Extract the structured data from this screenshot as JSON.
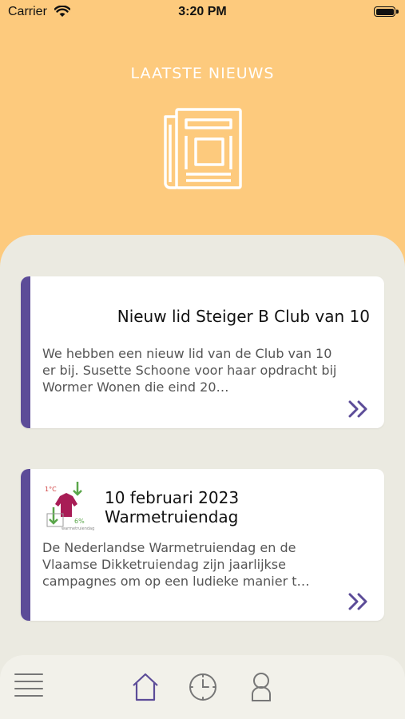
{
  "status_bar": {
    "carrier": "Carrier",
    "time": "3:20 PM"
  },
  "hero": {
    "title": "LAATSTE NIEUWS",
    "icon": "newspaper-icon",
    "color": "#fdca7d"
  },
  "news": [
    {
      "title": "Nieuw lid Steiger B Club van 10",
      "body": "We hebben een nieuw lid van de Club van 10 er bij. Susette Schoone voor haar opdracht bij Wormer Wonen die eind 20…"
    },
    {
      "title_line1": "10 februari 2023",
      "title_line2": "Warmetruiendag",
      "body": "De Nederlandse Warmetruiendag en de Vlaamse Dikketruiendag zijn jaarlijkse campagnes om op een ludieke manier t…",
      "thumbnail": "warmetruiendag-thumbnail"
    }
  ],
  "accent_color": "#5c4c98",
  "tabbar": {
    "items": [
      "menu-icon",
      "home-icon",
      "clock-icon",
      "user-icon"
    ],
    "active": "home-icon"
  }
}
